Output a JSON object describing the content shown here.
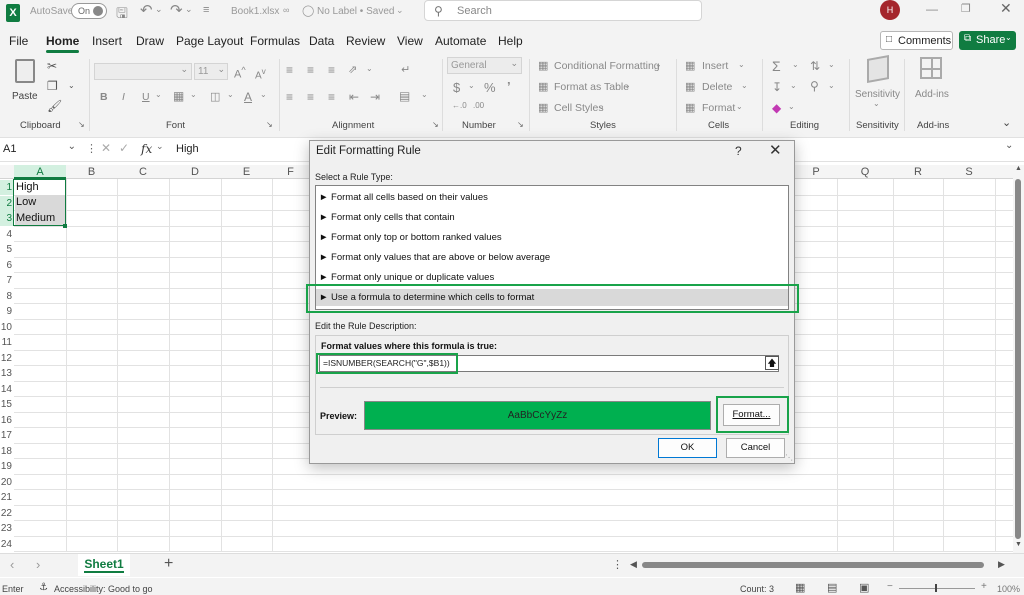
{
  "title_bar": {
    "autosave_label": "AutoSave",
    "autosave_state": "On",
    "filename": "Book1.xlsx",
    "label_status": "No Label • Saved",
    "search_placeholder": "Search",
    "avatar_initial": "H"
  },
  "menu": {
    "tabs": [
      "File",
      "Home",
      "Insert",
      "Draw",
      "Page Layout",
      "Formulas",
      "Data",
      "Review",
      "View",
      "Automate",
      "Help"
    ],
    "active_tab": "Home",
    "comments_label": "Comments",
    "share_label": "Share"
  },
  "ribbon": {
    "clipboard": {
      "paste": "Paste",
      "label": "Clipboard"
    },
    "font": {
      "size": "11",
      "label": "Font"
    },
    "alignment": {
      "label": "Alignment"
    },
    "number": {
      "format": "General",
      "label": "Number"
    },
    "styles": {
      "conditional": "Conditional Formatting",
      "table": "Format as Table",
      "cell_styles": "Cell Styles",
      "label": "Styles"
    },
    "cells": {
      "insert": "Insert",
      "delete": "Delete",
      "format": "Format",
      "label": "Cells"
    },
    "editing": {
      "label": "Editing"
    },
    "sensitivity": {
      "label": "Sensitivity",
      "group_label": "Sensitivity"
    },
    "addins": {
      "label": "Add-ins",
      "group_label": "Add-ins"
    }
  },
  "formula_bar": {
    "name_box": "A1",
    "fx": "fx",
    "content": "High"
  },
  "grid": {
    "columns": [
      "A",
      "B",
      "C",
      "D",
      "E",
      "F",
      "P",
      "Q",
      "R",
      "S"
    ],
    "rows": [
      "1",
      "2",
      "3",
      "4",
      "5",
      "6",
      "7",
      "8",
      "9",
      "10",
      "11",
      "12",
      "13",
      "14",
      "15",
      "16",
      "17",
      "18",
      "19",
      "20",
      "21",
      "22",
      "23",
      "24"
    ],
    "cells": [
      "High",
      "Low",
      "Medium"
    ]
  },
  "dialog": {
    "title": "Edit Formatting Rule",
    "help": "?",
    "select_rule_type_label": "Select a Rule Type:",
    "rule_types": [
      "► Format all cells based on their values",
      "► Format only cells that contain",
      "► Format only top or bottom ranked values",
      "► Format only values that are above or below average",
      "► Format only unique or duplicate values",
      "► Use a formula to determine which cells to format"
    ],
    "edit_desc_label": "Edit the Rule Description:",
    "formula_label": "Format values where this formula is true:",
    "formula_value": "=ISNUMBER(SEARCH(\"G\",$B1))",
    "preview_label": "Preview:",
    "preview_text": "AaBbCcYyZz",
    "preview_color": "#00b050",
    "format_button": "Format...",
    "ok_button": "OK",
    "cancel_button": "Cancel"
  },
  "sheet_bar": {
    "sheet_name": "Sheet1"
  },
  "status_bar": {
    "mode": "Enter",
    "accessibility": "Accessibility: Good to go",
    "count": "Count: 3",
    "zoom": "100%"
  },
  "colors": {
    "accent_green": "#107c41",
    "highlight_green": "#19a34a"
  }
}
